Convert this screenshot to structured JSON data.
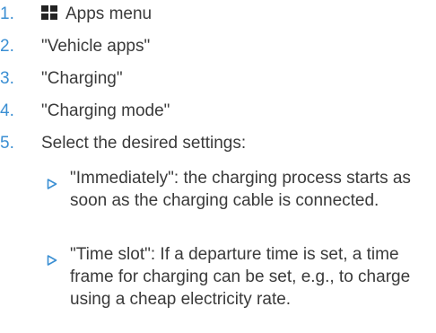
{
  "steps": [
    {
      "number": "1.",
      "icon": "apps-grid-icon",
      "text": "Apps menu"
    },
    {
      "number": "2.",
      "text": "\"Vehicle apps\""
    },
    {
      "number": "3.",
      "text": "\"Charging\""
    },
    {
      "number": "4.",
      "text": "\"Charging mode\""
    },
    {
      "number": "5.",
      "text": "Select the desired settings:"
    }
  ],
  "sub_items": [
    {
      "text": "\"Immediately\": the charging process starts as soon as the charging cable is connected."
    },
    {
      "text": "\"Time slot\": If a departure time is set, a time frame for charging can be set, e.g., to charge using a cheap electricity rate."
    }
  ],
  "colors": {
    "step_number": "#3b8fd3",
    "body_text": "#3a3a3a",
    "bullet_triangle": "#3b8fd3",
    "icon": "#222222"
  }
}
